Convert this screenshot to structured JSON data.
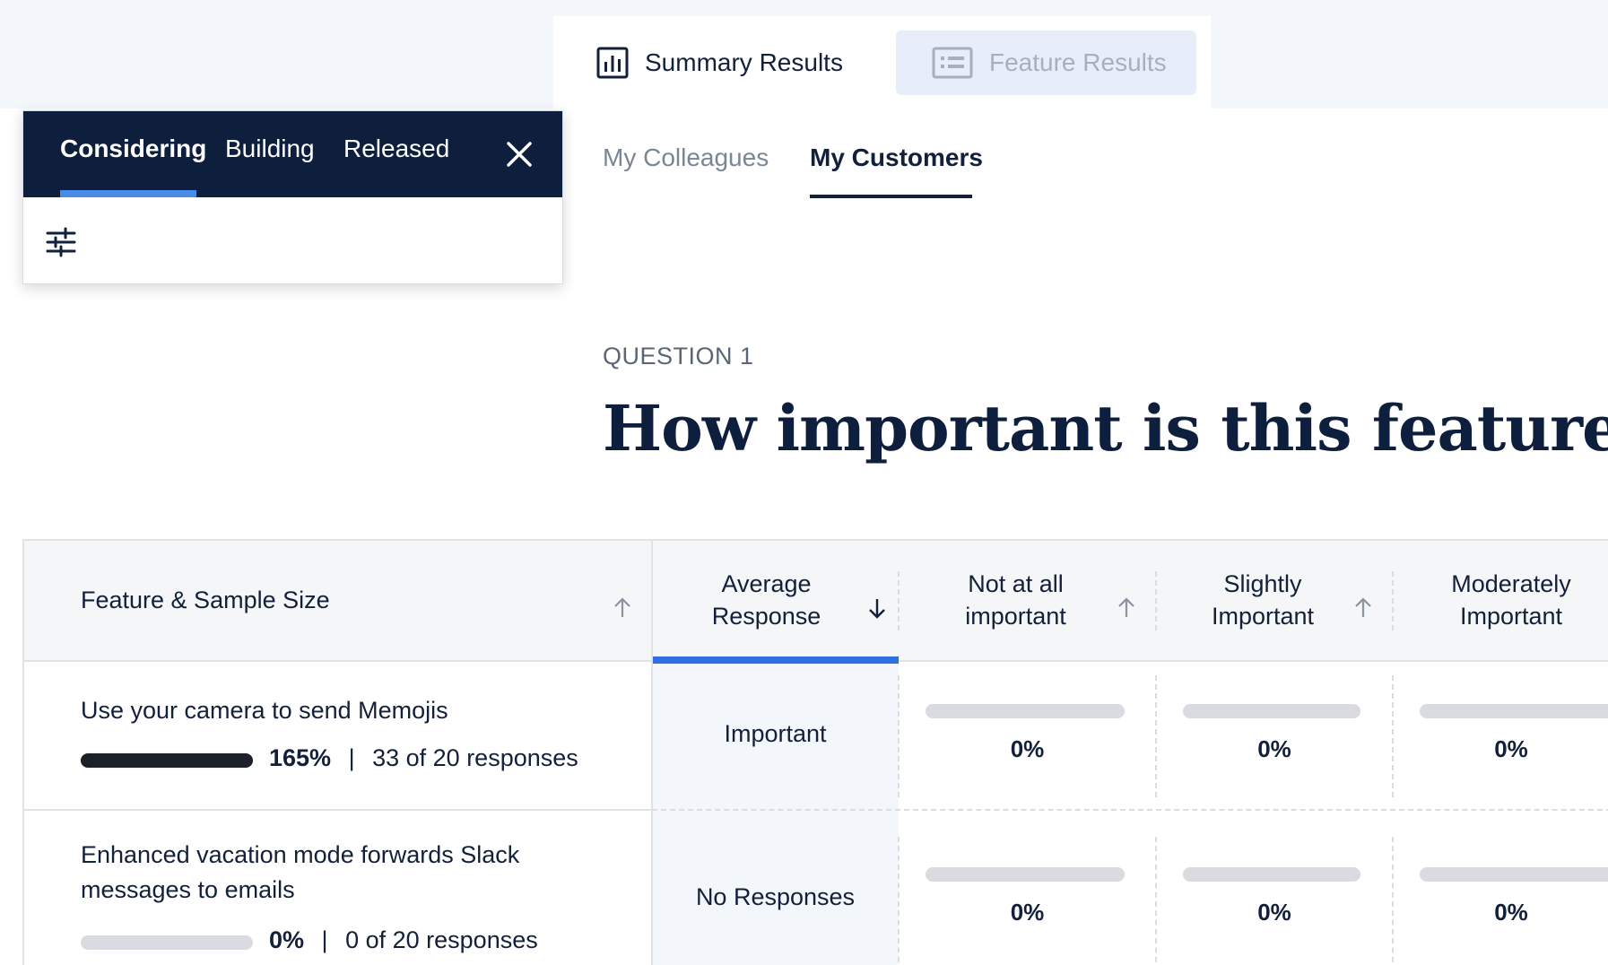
{
  "top_tabs": [
    {
      "label": "Summary Results",
      "icon": "bar-chart-icon",
      "active": true
    },
    {
      "label": "Feature Results",
      "icon": "list-icon",
      "active": false
    }
  ],
  "status_popover": {
    "tabs": [
      "Considering",
      "Building",
      "Released"
    ],
    "active_tab": "Considering",
    "close_icon": "close-icon",
    "filter_icon": "filter-sliders-icon"
  },
  "audience_tabs": [
    {
      "label": "My Colleagues",
      "active": false
    },
    {
      "label": "My Customers",
      "active": true
    }
  ],
  "question": {
    "label": "QUESTION 1",
    "title": "How important is this feature to yo"
  },
  "table": {
    "columns": [
      {
        "label": "Feature & Sample Size",
        "sort": "up"
      },
      {
        "label": "Average Response",
        "sort": "down",
        "active": true
      },
      {
        "label": "Not at all important",
        "sort": "up"
      },
      {
        "label": "Slightly Important",
        "sort": "up"
      },
      {
        "label": "Moderately Important",
        "sort": ""
      }
    ],
    "rows": [
      {
        "feature": "Use your camera to send Memojis",
        "sample_fraction": 1.0,
        "sample_pct": "165%",
        "separator": "|",
        "responses": "33 of 20 responses",
        "average": "Important",
        "distribution": [
          "0%",
          "0%",
          "0%"
        ]
      },
      {
        "feature": "Enhanced vacation mode forwards Slack messages to emails",
        "sample_fraction": 0.0,
        "sample_pct": "0%",
        "separator": "|",
        "responses": "0 of 20 responses",
        "average": "No Responses",
        "distribution": [
          "0%",
          "0%",
          "0%"
        ]
      }
    ]
  },
  "colors": {
    "navy": "#0e1f3d",
    "accent_blue": "#2f6fe0",
    "tab_underline": "#4a8be8",
    "bar_track": "#d9dbe0",
    "bar_fill": "#1b1f27"
  }
}
